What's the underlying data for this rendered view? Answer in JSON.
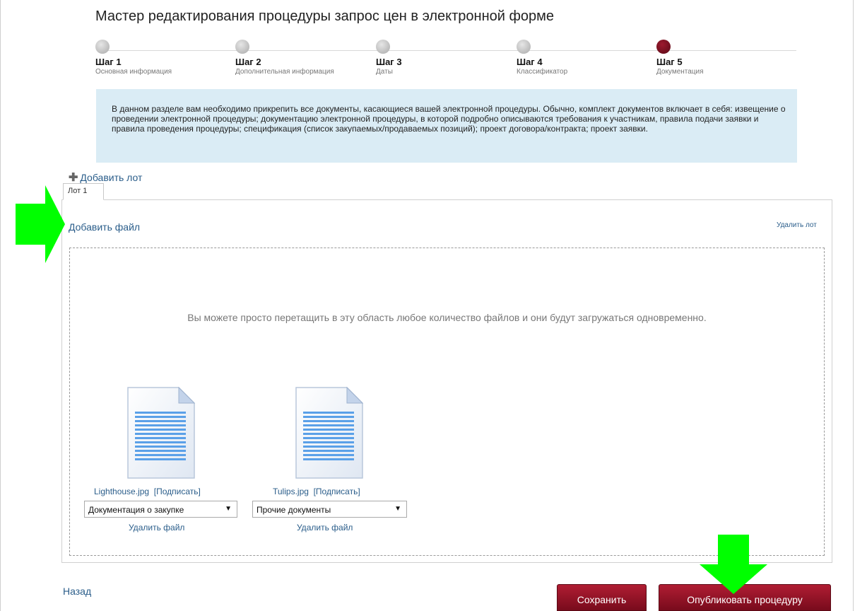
{
  "title": "Мастер редактирования процедуры  запрос цен в электронной форме",
  "steps": [
    {
      "name": "Шаг 1",
      "desc": "Основная информация",
      "active": false
    },
    {
      "name": "Шаг 2",
      "desc": "Дополнительная информация",
      "active": false
    },
    {
      "name": "Шаг 3",
      "desc": "Даты",
      "active": false
    },
    {
      "name": "Шаг 4",
      "desc": "Классификатор",
      "active": false
    },
    {
      "name": "Шаг 5",
      "desc": "Документация",
      "active": true
    }
  ],
  "info_text": "В данном разделе вам необходимо прикрепить все документы, касающиеся вашей электронной процедуры. Обычно, комплект документов включает в себя: извещение о проведении электронной процедуры; документацию электронной процедуры, в которой подробно описываются требования к участникам, правила подачи заявки и правила проведения процедуры; спецификация (список закупаемых/продаваемых позиций); проект договора/контракта; проект заявки.",
  "add_lot": "Добавить лот",
  "tab_lot": "Лот 1",
  "add_file": "Добавить файл",
  "delete_lot": "Удалить лот",
  "drop_hint": "Вы можете просто перетащить в эту область любое количество файлов и они будут загружаться одновременно.",
  "files": [
    {
      "name": "Lighthouse.jpg",
      "sign": "[Подписать]",
      "category": "Документация о закупке",
      "delete": "Удалить файл"
    },
    {
      "name": "Tulips.jpg",
      "sign": "[Подписать]",
      "category": "Прочие документы",
      "delete": "Удалить файл"
    }
  ],
  "back": "Назад",
  "save_button": "Сохранить",
  "publish_button": "Опубликовать процедуру",
  "colors": {
    "accent": "#8b1226",
    "link": "#2a5d8a",
    "info_bg": "#daecf5",
    "annotation_arrow": "#00ff00"
  }
}
